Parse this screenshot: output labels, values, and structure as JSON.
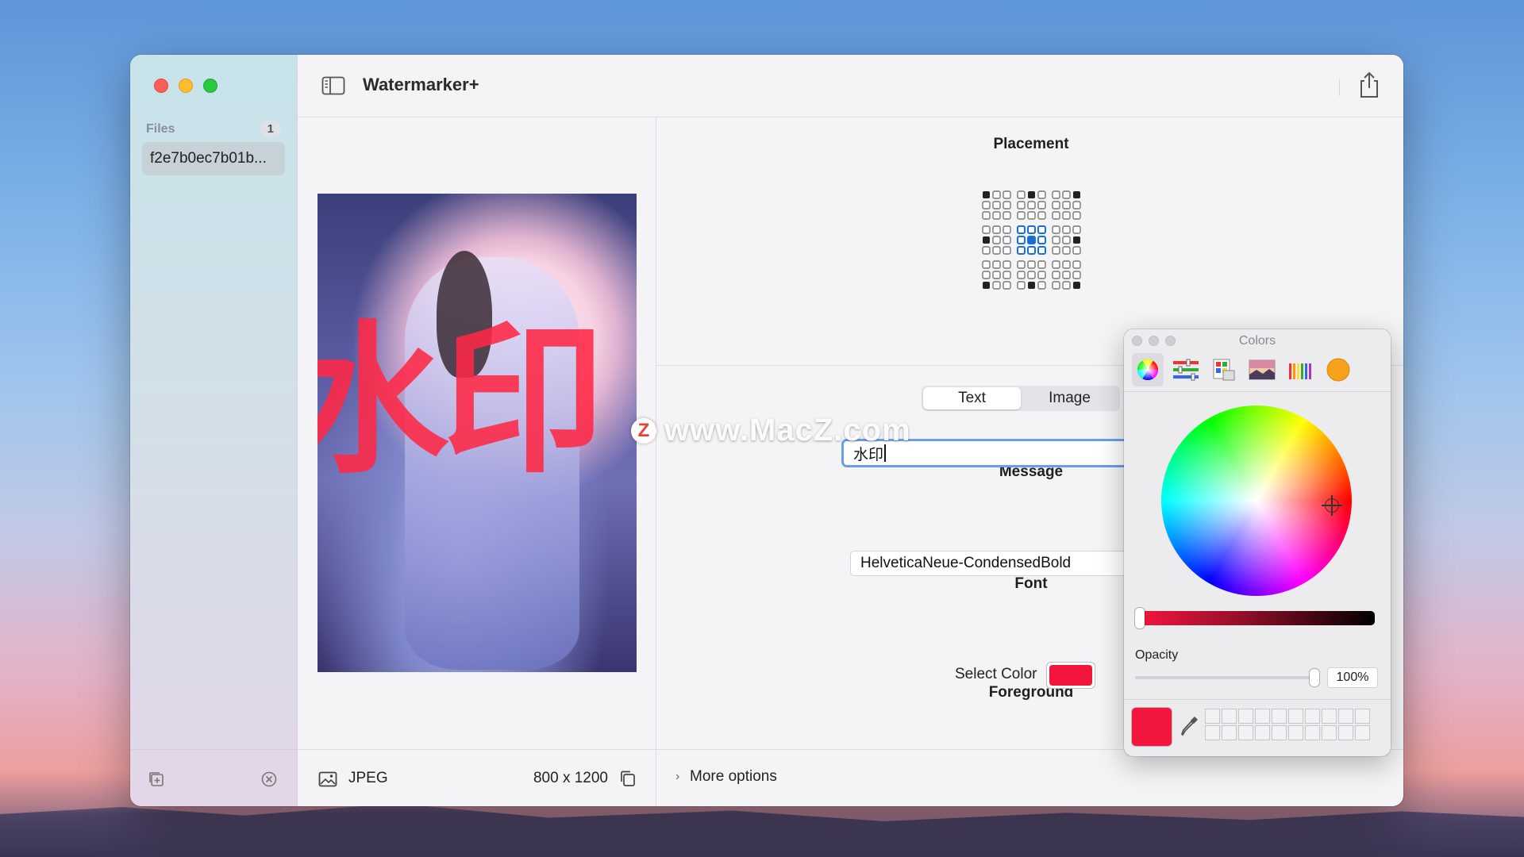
{
  "app": {
    "title": "Watermarker+"
  },
  "sidebar": {
    "files_label": "Files",
    "files_count": "1",
    "items": [
      {
        "label": "f2e7b0ec7b01b..."
      }
    ]
  },
  "preview": {
    "watermark_text": "水印",
    "format": "JPEG",
    "dimensions": "800 x 1200"
  },
  "settings": {
    "placement_title": "Placement",
    "placement_selected": "center",
    "tabs": [
      {
        "label": "Text",
        "active": true
      },
      {
        "label": "Image",
        "active": false
      }
    ],
    "message_title": "Message",
    "message_value": "水印",
    "font_title": "Font",
    "font_value": "HelveticaNeue-CondensedBold",
    "foreground_title": "Foreground",
    "select_color_label": "Select Color",
    "foreground_color": "#f2163c",
    "more_options_label": "More options"
  },
  "colors_panel": {
    "title": "Colors",
    "mode_icons": [
      "color-wheel-icon",
      "sliders-icon",
      "palettes-icon",
      "image-palette-icon",
      "pencils-icon",
      "crayon-icon"
    ],
    "opacity_label": "Opacity",
    "opacity_value": "100%",
    "opacity_level": 1.0,
    "current_color": "#f2163c"
  },
  "overlay": {
    "site_logo": "Z",
    "site_text": "www.MacZ.com"
  }
}
